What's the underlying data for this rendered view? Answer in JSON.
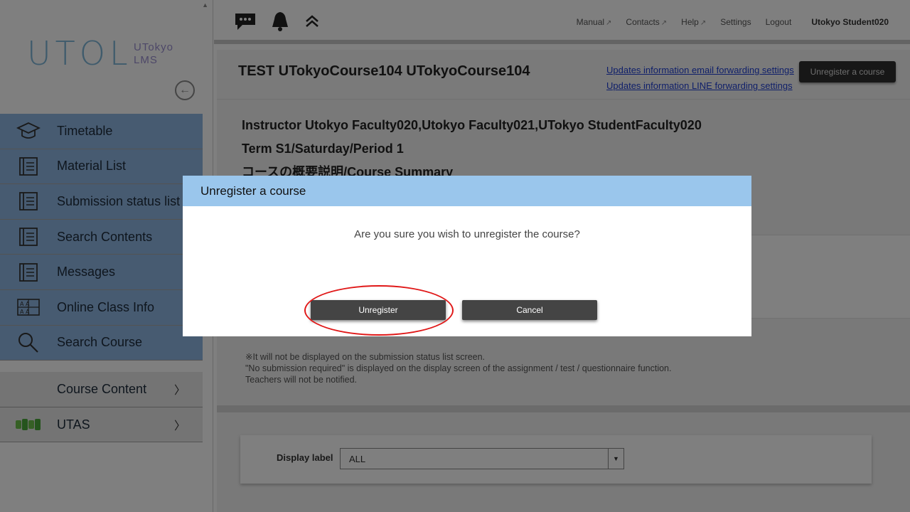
{
  "logo": {
    "main": "UTOL",
    "sub_line1": "UTokyo",
    "sub_line2": "LMS"
  },
  "sidebar": {
    "items": [
      {
        "label": "Timetable",
        "icon": "mortarboard-icon"
      },
      {
        "label": "Material List",
        "icon": "notebook-icon"
      },
      {
        "label": "Submission status list",
        "icon": "notebook-icon"
      },
      {
        "label": "Search Contents",
        "icon": "notebook-icon"
      },
      {
        "label": "Messages",
        "icon": "notebook-icon"
      },
      {
        "label": "Online Class Info",
        "icon": "grid-icon"
      },
      {
        "label": "Search Course",
        "icon": "magnifier-icon"
      }
    ],
    "lower_items": [
      {
        "label": "Course Content",
        "chevron": "〉"
      },
      {
        "label": "UTAS",
        "chevron": "〉",
        "icon": "utas-logo-icon"
      }
    ]
  },
  "header": {
    "links": {
      "manual": "Manual",
      "contacts": "Contacts",
      "help": "Help",
      "settings": "Settings",
      "logout": "Logout",
      "user": "Utokyo Student020"
    }
  },
  "course": {
    "title": "TEST UTokyoCourse104 UTokyoCourse104",
    "email_link": "Updates information email forwarding settings",
    "line_link": "Updates information LINE forwarding settings",
    "unregister_button": "Unregister a course",
    "instructor": "Instructor Utokyo Faculty020,Utokyo Faculty021,UTokyo StudentFaculty020",
    "term": "Term S1/Saturday/Period 1",
    "summary": "コースの概要説明/Course Summary"
  },
  "notes": {
    "line1": "※It will not be displayed on the submission status list screen.",
    "line2": "\"No submission required\" is displayed on the display screen of the assignment / test / questionnaire function.",
    "line3": "Teachers will not be notified."
  },
  "display_label": {
    "label": "Display label",
    "value": "ALL"
  },
  "modal": {
    "title": "Unregister a course",
    "message": "Are you sure you wish to unregister the course?",
    "confirm_label": "Unregister",
    "cancel_label": "Cancel",
    "highlight_color": "#e01818",
    "header_color": "#9ac6ec"
  }
}
